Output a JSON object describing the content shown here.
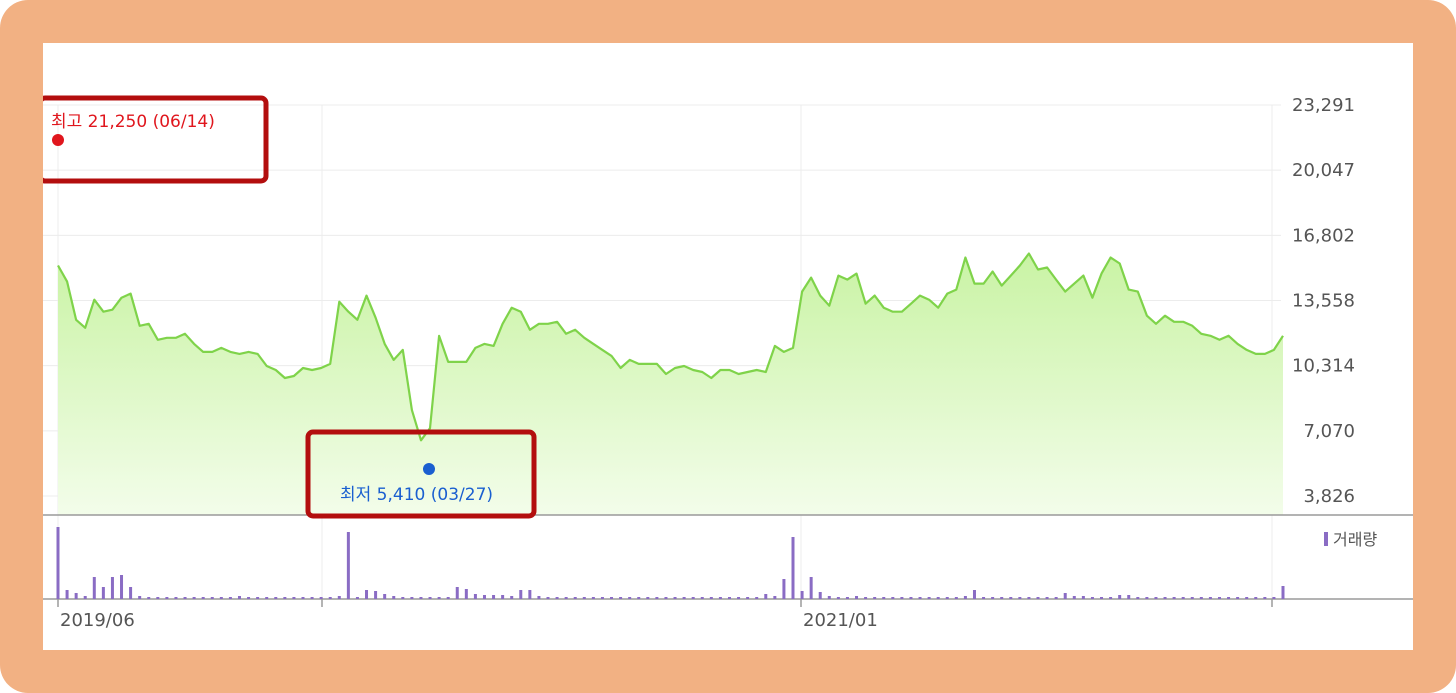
{
  "chart_data": {
    "type": "area",
    "y_ticks": [
      "23,291",
      "20,047",
      "16,802",
      "13,558",
      "10,314",
      "7,070",
      "3,826"
    ],
    "y_tick_values": [
      23291,
      20047,
      16802,
      13558,
      10314,
      7070,
      3826
    ],
    "x_tick_labels": [
      {
        "label": "2019/06",
        "index": 0
      },
      {
        "label": "2021/01",
        "index": 80
      }
    ],
    "high": {
      "label": "최고 21,250 (06/14)",
      "value": 21250
    },
    "low": {
      "label": "최저 5,410 (03/27)",
      "value": 5410,
      "index": 39
    },
    "volume_legend": "거래량",
    "colors": {
      "line": "#7fd34a",
      "fill_top": "#c9f3a4",
      "fill_bottom": "#f3fdea",
      "volume": "#8a6cc4",
      "high": "#e0161d",
      "low": "#1a5fd0",
      "highlight_box": "#b30e0e"
    },
    "prices": [
      15300,
      14500,
      12600,
      12200,
      13600,
      13000,
      13100,
      13700,
      13900,
      12300,
      12400,
      11600,
      11700,
      11700,
      11900,
      11400,
      11000,
      11000,
      11200,
      11000,
      10900,
      11000,
      10900,
      10300,
      10100,
      9700,
      9800,
      10200,
      10100,
      10200,
      10400,
      13500,
      13000,
      12600,
      13800,
      12700,
      11400,
      10600,
      11100,
      8100,
      6600,
      7200,
      11800,
      10500,
      10500,
      10500,
      11200,
      11400,
      11300,
      12400,
      13200,
      13000,
      12100,
      12400,
      12400,
      12500,
      11900,
      12100,
      11700,
      11400,
      11100,
      10800,
      10200,
      10600,
      10400,
      10400,
      10400,
      9900,
      10200,
      10300,
      10100,
      10000,
      9700,
      10100,
      10100,
      9900,
      10000,
      10100,
      10000,
      11300,
      11000,
      11200,
      14000,
      14700,
      13800,
      13300,
      14800,
      14600,
      14900,
      13400,
      13800,
      13200,
      13000,
      13000,
      13400,
      13800,
      13600,
      13200,
      13900,
      14100,
      15700,
      14400,
      14400,
      15000,
      14300,
      14800,
      15300,
      15900,
      15100,
      15200,
      14600,
      14000,
      14400,
      14800,
      13700,
      14900,
      15700,
      15400,
      14100,
      14000,
      12800,
      12400,
      12800,
      12500,
      12500,
      12300,
      11900,
      11800,
      11600,
      11800,
      11400,
      11100,
      10900,
      10900,
      11100,
      11800
    ],
    "volumes": [
      72,
      9,
      6,
      3,
      22,
      12,
      22,
      24,
      12,
      3,
      2,
      2,
      2,
      2,
      2,
      2,
      2,
      2,
      2,
      2,
      3,
      2,
      2,
      2,
      2,
      2,
      2,
      2,
      2,
      2,
      2,
      3,
      67,
      2,
      9,
      8,
      5,
      3,
      2,
      2,
      2,
      2,
      2,
      2,
      12,
      10,
      5,
      4,
      4,
      4,
      3,
      9,
      9,
      3,
      2,
      2,
      2,
      2,
      2,
      2,
      2,
      2,
      2,
      2,
      2,
      2,
      2,
      2,
      2,
      2,
      2,
      2,
      2,
      2,
      2,
      2,
      2,
      2,
      5,
      3,
      20,
      62,
      8,
      22,
      7,
      3,
      2,
      2,
      3,
      2,
      2,
      2,
      2,
      2,
      2,
      2,
      2,
      2,
      2,
      2,
      3,
      9,
      2,
      2,
      2,
      2,
      2,
      2,
      2,
      2,
      2,
      6,
      3,
      3,
      2,
      2,
      2,
      4,
      4,
      2,
      2,
      2,
      2,
      2,
      2,
      2,
      2,
      2,
      2,
      2,
      2,
      2,
      2,
      2,
      2,
      13
    ]
  }
}
